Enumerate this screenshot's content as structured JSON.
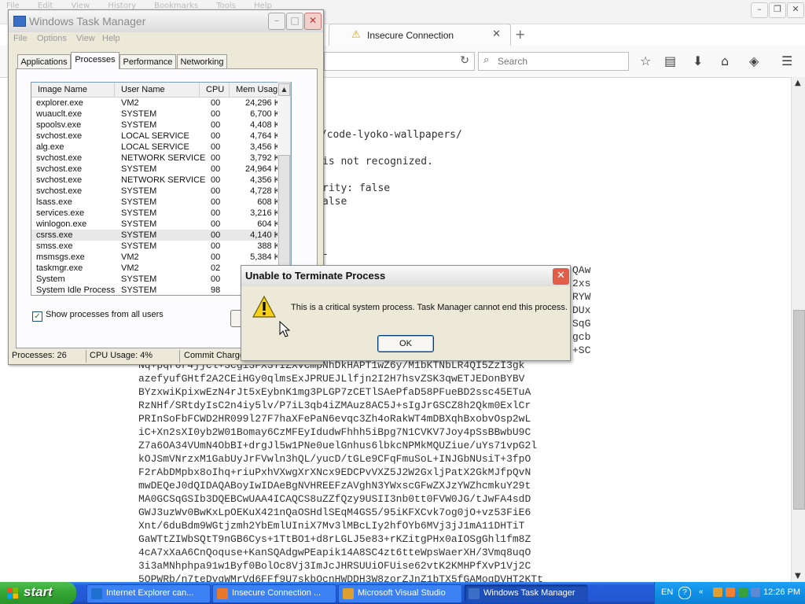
{
  "firefox": {
    "menu": [
      "File",
      "Edit",
      "View",
      "History",
      "Bookmarks",
      "Tools",
      "Help"
    ],
    "tab_title": "Insecure Connection",
    "search_placeholder": "Search",
    "content": {
      "url_line": "m/code-lyoko-wallpapers/",
      "error_line": "is not recognized.",
      "line_authority": "rity: false",
      "line_false": "alse",
      "line_dash": "-",
      "right_col": [
        "QAw",
        "2xs",
        "RYW",
        "DUx",
        "SqG",
        "gcb",
        "+SC"
      ],
      "base64": [
        "Nq+pqr0r4jjcl+3cgi3FX3TIZXvCmpNhDkHAPT1wZ6y/M1bKTNbLR4QI5ZzI3gk",
        "azefyufGHtf2A2CEiHGy0qlmsExJPRUEJLlfjn2I2H7hsvZSK3qwETJEDonBYBV",
        "BYzxwiKpixwEzN4rJt5xEybnK1mg3PLGP7zCETlSAePfaD58PFueBD2ssc45ETuA",
        "RzNHf/SRtdyIsC2n4iy5lv/P7iL3qb4iZMAuz8AC5J+sIgJrGSCZ8h2Qkm0ExlCr",
        "PRInSoFbFCWD2HR099l27F7haXFePaN6evqc3Zh4oRakWT4mDBXqhBxobvOsp2wL",
        "iC+Xn2sXI0yb2W01Bomay6CzMFEyIdudwFhhh5iBpg7N1CVKV7Joy4pSsBBwbU9C",
        "Z7a6OA34VUmN4ObBI+drgJl5w1PNe0uelGnhus6lbkcNPMkMQUZiue/uYs71vpG2l",
        "kOJSmVNrzxM1GabUyJrFVwln3hQL/yucD/tGLe9CFqFmuSoL+INJGbNUsiT+3fpO",
        "F2rAbDMpbx8oIhq+riuPxhVXwgXrXNcx9EDCPvVXZ5J2W2GxljPatX2GkMJfpQvN",
        "mwDEQeJ0dQIDAQABoyIwIDAeBgNVHREEFzAVghN3YWxscGFwZXJzYWZhcmkuY29t",
        "MA0GCSqGSIb3DQEBCwUAA4ICAQCS8uZZfQzy9USII3nb0tt0FVW0JG/tJwFA4sdD",
        "GWJ3uzWv0BwKxLpOEKuX421nQaOSHdlSEqM4GS5/95iKFXCvk7og0jO+vz53FiE6",
        "Xnt/6duBdm9WGtjzmh2YbEmlUIniX7Mv3lMBcLIy2hfOYb6MVj3jJ1mA11DHTiT",
        "GaWTtZIWbSQtT9nGB6Cys+1TtBO1+d8rLGLJ5e83+rKZitgPHx0aIOSgGhl1fm8Z",
        "4cA7xXaA6CnQoquse+KanSQAdgwPEapik14A8SC4zt6tteWpsWaerXH/3Vmq8uqO",
        "3i3aMNhphpa91w1Byf0BolOc8Vj3ImJcJHRSUUiOFUise62vtK2KMHPfXvP1Vj2C",
        "5OPWRb/n7teDvgWMrVd6FFf9U7skbOcnHWDDH3W8zorZJnZ1bTX5fGAMogDVHT2KTt"
      ]
    }
  },
  "task_manager": {
    "title": "Windows Task Manager",
    "menu": [
      "File",
      "Options",
      "View",
      "Help"
    ],
    "tabs": [
      "Applications",
      "Processes",
      "Performance",
      "Networking"
    ],
    "active_tab": "Processes",
    "columns": [
      "Image Name",
      "User Name",
      "CPU",
      "Mem Usage"
    ],
    "processes": [
      {
        "name": "explorer.exe",
        "user": "VM2",
        "cpu": "00",
        "mem": "24,296 K"
      },
      {
        "name": "wuauclt.exe",
        "user": "SYSTEM",
        "cpu": "00",
        "mem": "6,700 K"
      },
      {
        "name": "spoolsv.exe",
        "user": "SYSTEM",
        "cpu": "00",
        "mem": "4,408 K"
      },
      {
        "name": "svchost.exe",
        "user": "LOCAL SERVICE",
        "cpu": "00",
        "mem": "4,764 K"
      },
      {
        "name": "alg.exe",
        "user": "LOCAL SERVICE",
        "cpu": "00",
        "mem": "3,456 K"
      },
      {
        "name": "svchost.exe",
        "user": "NETWORK SERVICE",
        "cpu": "00",
        "mem": "3,792 K"
      },
      {
        "name": "svchost.exe",
        "user": "SYSTEM",
        "cpu": "00",
        "mem": "24,964 K"
      },
      {
        "name": "svchost.exe",
        "user": "NETWORK SERVICE",
        "cpu": "00",
        "mem": "4,356 K"
      },
      {
        "name": "svchost.exe",
        "user": "SYSTEM",
        "cpu": "00",
        "mem": "4,728 K"
      },
      {
        "name": "lsass.exe",
        "user": "SYSTEM",
        "cpu": "00",
        "mem": "608 K"
      },
      {
        "name": "services.exe",
        "user": "SYSTEM",
        "cpu": "00",
        "mem": "3,216 K"
      },
      {
        "name": "winlogon.exe",
        "user": "SYSTEM",
        "cpu": "00",
        "mem": "604 K"
      },
      {
        "name": "csrss.exe",
        "user": "SYSTEM",
        "cpu": "00",
        "mem": "4,140 K",
        "selected": true
      },
      {
        "name": "smss.exe",
        "user": "SYSTEM",
        "cpu": "00",
        "mem": "388 K"
      },
      {
        "name": "msmsgs.exe",
        "user": "VM2",
        "cpu": "00",
        "mem": "5,384 K"
      },
      {
        "name": "taskmgr.exe",
        "user": "VM2",
        "cpu": "02",
        "mem": ""
      },
      {
        "name": "System",
        "user": "SYSTEM",
        "cpu": "00",
        "mem": ""
      },
      {
        "name": "System Idle Process",
        "user": "SYSTEM",
        "cpu": "98",
        "mem": ""
      }
    ],
    "show_all_label": "Show processes from all users",
    "show_all_checked": true,
    "status": {
      "processes": "Processes: 26",
      "cpu": "CPU Usage: 4%",
      "commit": "Commit Charge"
    }
  },
  "dialog": {
    "title": "Unable to Terminate Process",
    "message": "This is a critical system process.  Task Manager cannot end this process.",
    "ok_label": "OK"
  },
  "taskbar": {
    "start_label": "start",
    "tasks": [
      {
        "label": "Internet Explorer can...",
        "icon_color": "#1f6fd0",
        "active": false
      },
      {
        "label": "Insecure Connection ...",
        "icon_color": "#e8782a",
        "active": false
      },
      {
        "label": "Microsoft Visual Studio",
        "icon_color": "#e0a030",
        "active": false
      },
      {
        "label": "Windows Task Manager",
        "icon_color": "#3a6fc7",
        "active": true
      }
    ],
    "tray": {
      "language": "EN",
      "clock": "12:26 PM"
    }
  }
}
